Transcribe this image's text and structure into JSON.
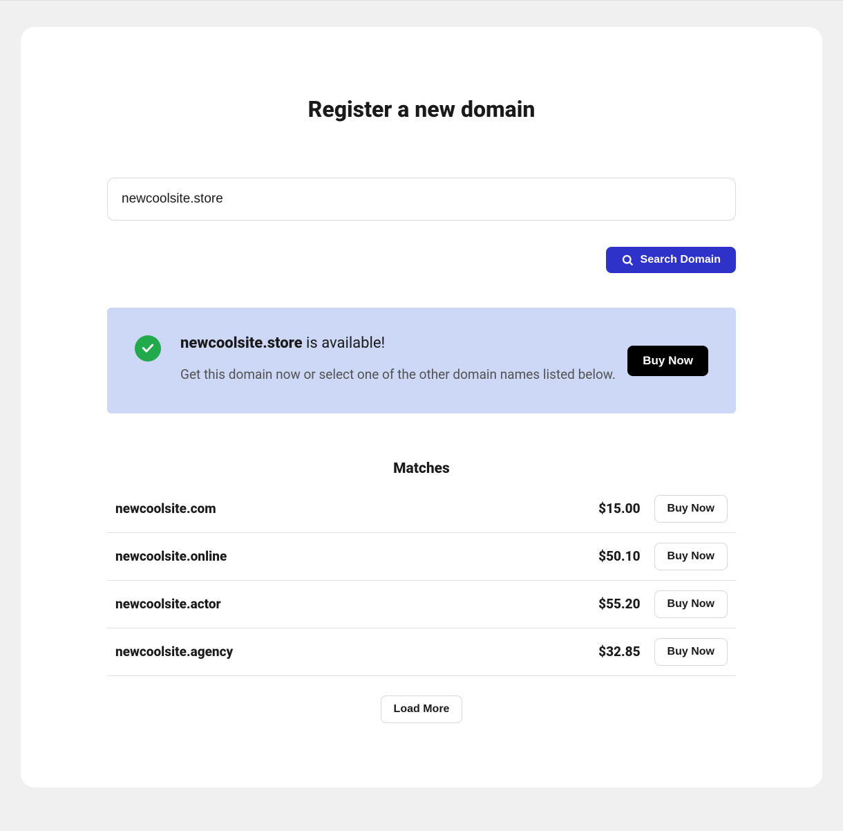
{
  "header": {
    "title": "Register a new domain"
  },
  "search": {
    "value": "newcoolsite.store",
    "button_label": "Search Domain"
  },
  "availability": {
    "domain": "newcoolsite.store",
    "suffix": " is available!",
    "subtext": "Get this domain now or select one of the other domain names listed below.",
    "buy_label": "Buy Now"
  },
  "matches": {
    "title": "Matches",
    "rows": [
      {
        "name": "newcoolsite.com",
        "price": "$15.00",
        "buy_label": "Buy Now"
      },
      {
        "name": "newcoolsite.online",
        "price": "$50.10",
        "buy_label": "Buy Now"
      },
      {
        "name": "newcoolsite.actor",
        "price": "$55.20",
        "buy_label": "Buy Now"
      },
      {
        "name": "newcoolsite.agency",
        "price": "$32.85",
        "buy_label": "Buy Now"
      }
    ],
    "load_more_label": "Load More"
  }
}
